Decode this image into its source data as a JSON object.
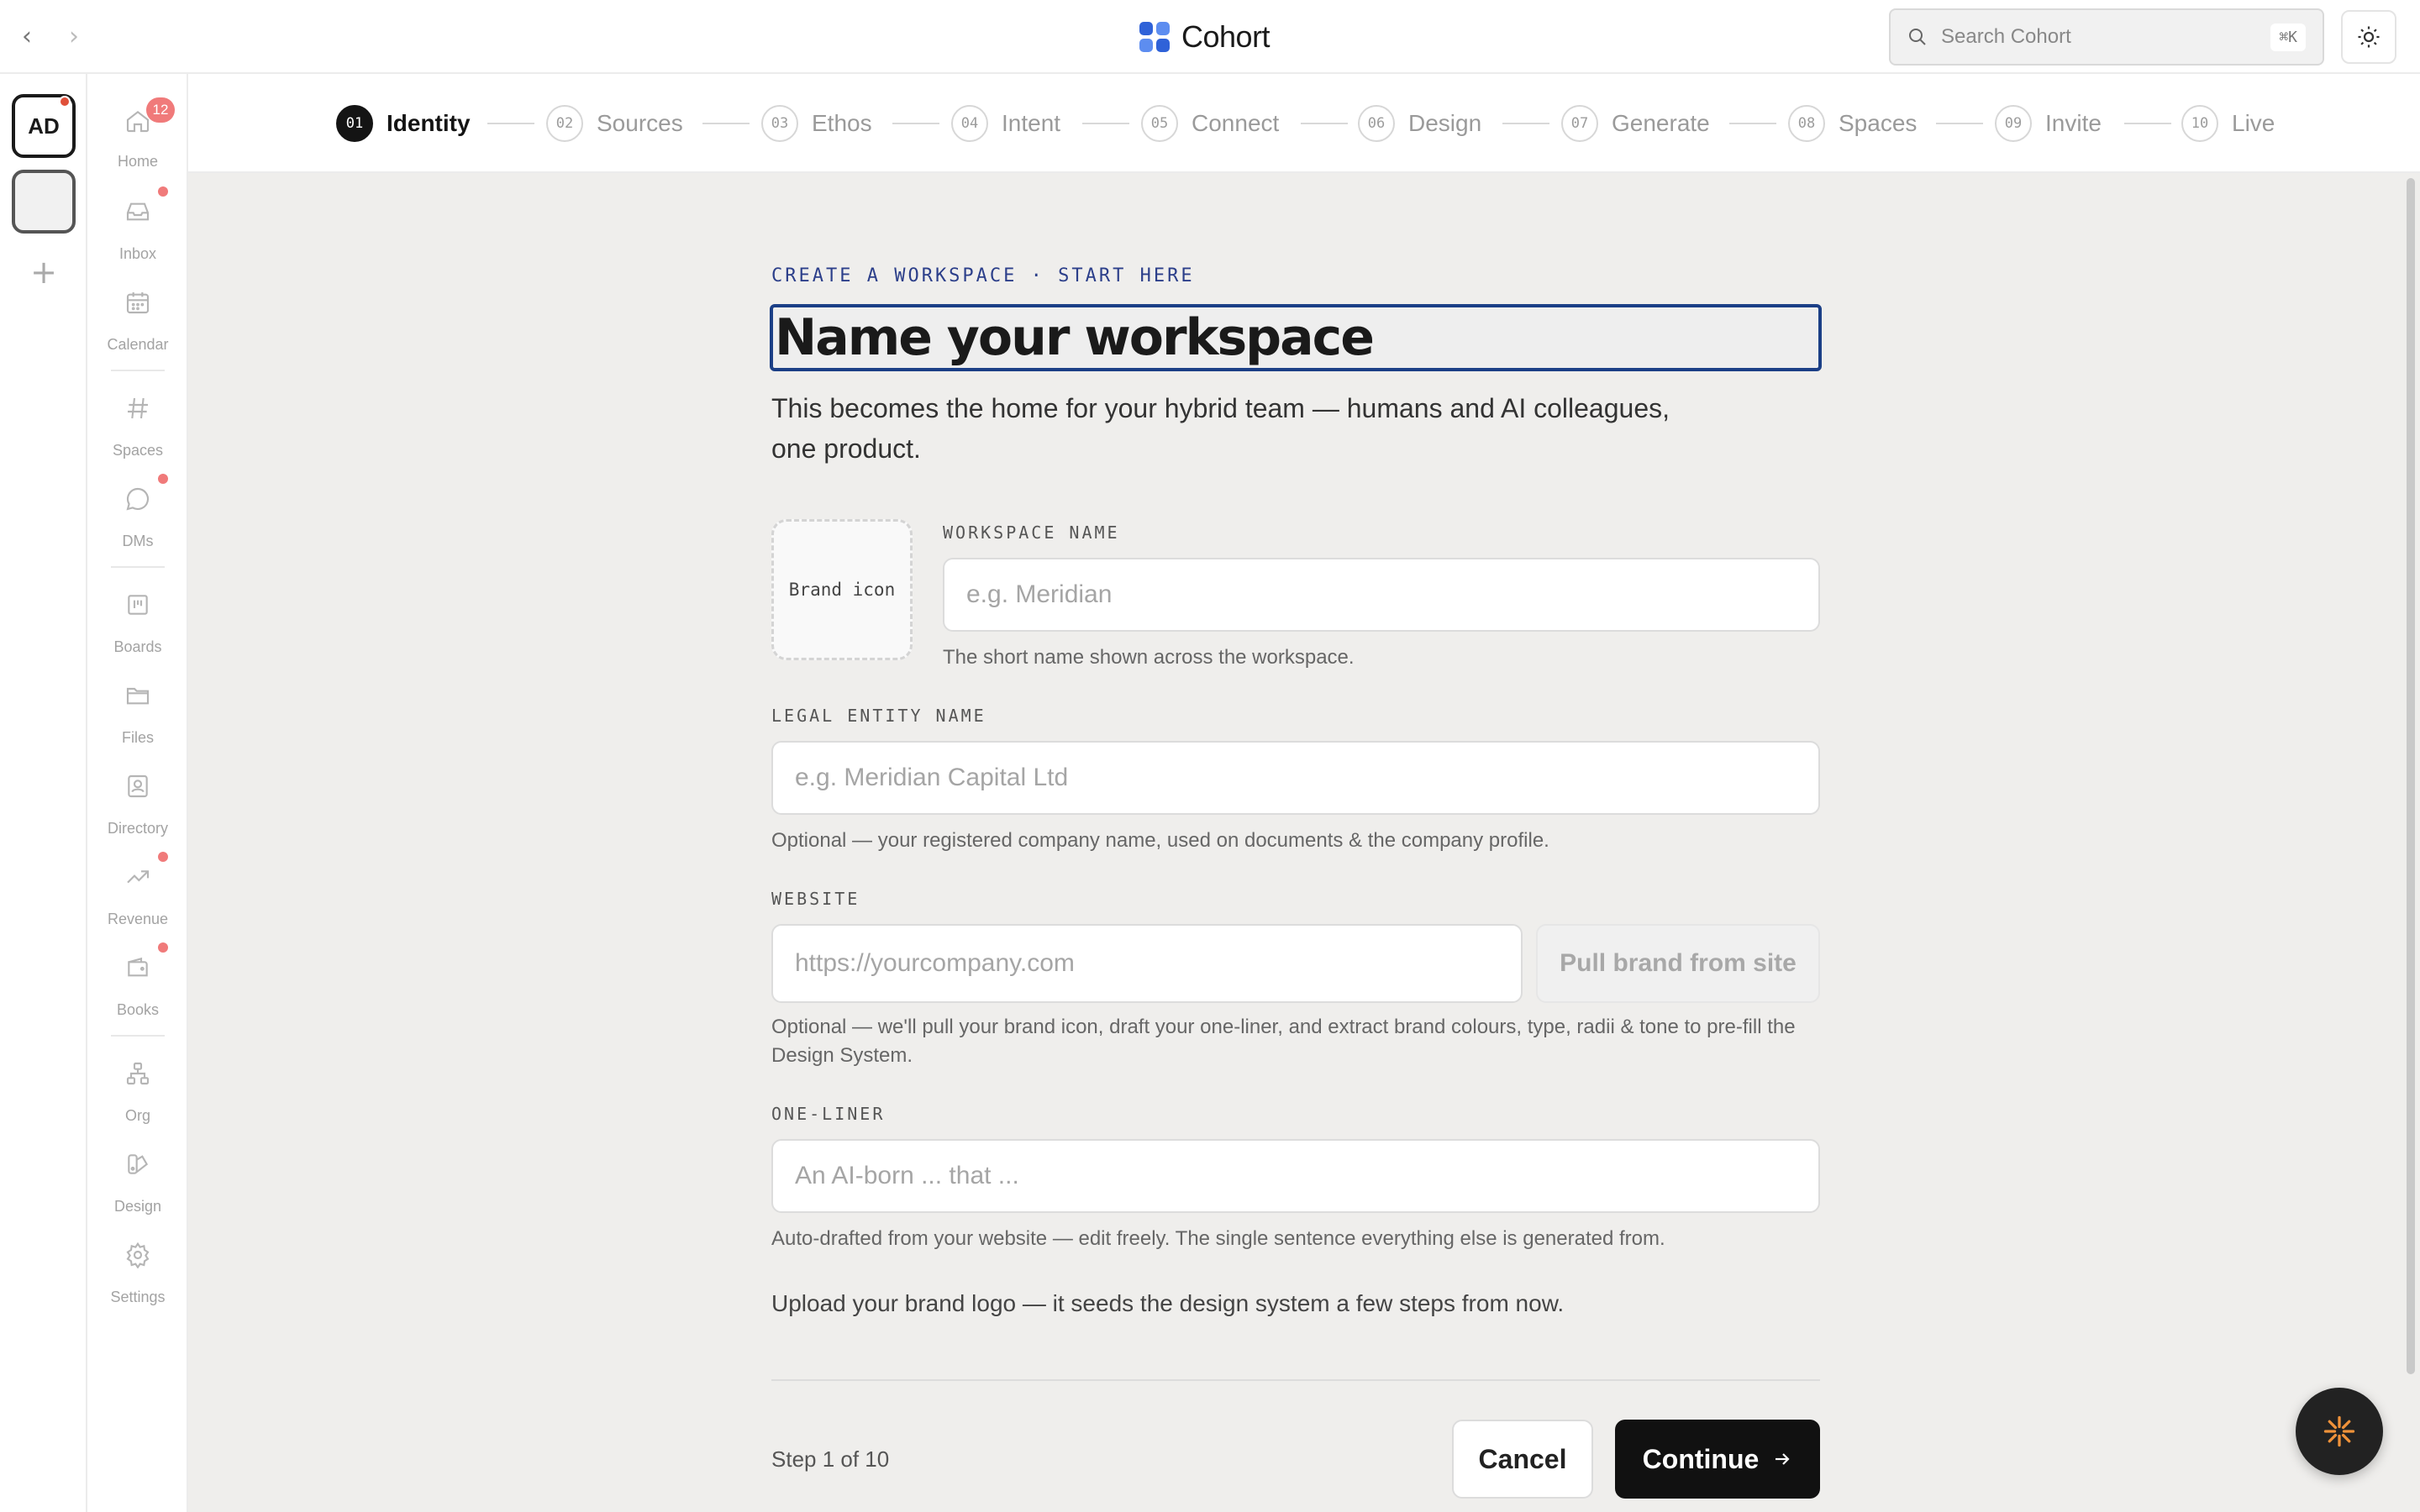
{
  "app": {
    "name": "Cohort"
  },
  "topbar": {
    "back_label": "‹",
    "forward_label": "›",
    "search_placeholder": "Search Cohort",
    "search_shortcut": "⌘K",
    "theme_icon": "sun-icon"
  },
  "rail": {
    "workspace_initials": "AD",
    "add_label": "+"
  },
  "sidebar": {
    "items": [
      {
        "label": "Home",
        "icon": "home-icon",
        "badge": "12"
      },
      {
        "label": "Inbox",
        "icon": "inbox-icon",
        "dot": true
      },
      {
        "label": "Calendar",
        "icon": "calendar-icon"
      },
      {
        "label": "Spaces",
        "icon": "hash-icon"
      },
      {
        "label": "DMs",
        "icon": "chat-bubble-icon",
        "dot": true
      },
      {
        "label": "Boards",
        "icon": "board-icon"
      },
      {
        "label": "Files",
        "icon": "folder-icon"
      },
      {
        "label": "Directory",
        "icon": "contact-book-icon"
      },
      {
        "label": "Revenue",
        "icon": "trend-up-icon",
        "dot": true
      },
      {
        "label": "Books",
        "icon": "wallet-icon",
        "dot": true
      },
      {
        "label": "Org",
        "icon": "org-chart-icon"
      },
      {
        "label": "Design",
        "icon": "palette-icon"
      },
      {
        "label": "Settings",
        "icon": "gear-icon"
      }
    ]
  },
  "stepper": {
    "steps": [
      {
        "num": "01",
        "label": "Identity",
        "active": true
      },
      {
        "num": "02",
        "label": "Sources"
      },
      {
        "num": "03",
        "label": "Ethos"
      },
      {
        "num": "04",
        "label": "Intent"
      },
      {
        "num": "05",
        "label": "Connect"
      },
      {
        "num": "06",
        "label": "Design"
      },
      {
        "num": "07",
        "label": "Generate"
      },
      {
        "num": "08",
        "label": "Spaces"
      },
      {
        "num": "09",
        "label": "Invite"
      },
      {
        "num": "10",
        "label": "Live"
      }
    ]
  },
  "form": {
    "eyebrow": "CREATE A WORKSPACE · START HERE",
    "title_placeholder": "Name your workspace",
    "subtitle": "This becomes the home for your hybrid team — humans and AI colleagues, one product.",
    "brand_icon_label": "Brand icon",
    "workspace_name": {
      "label": "WORKSPACE NAME",
      "placeholder": "e.g. Meridian",
      "hint": "The short name shown across the workspace."
    },
    "legal_name": {
      "label": "LEGAL ENTITY NAME",
      "placeholder": "e.g. Meridian Capital Ltd",
      "hint": "Optional — your registered company name, used on documents & the company profile."
    },
    "website": {
      "label": "WEBSITE",
      "placeholder": "https://yourcompany.com",
      "button": "Pull brand from site",
      "hint": "Optional — we'll pull your brand icon, draft your one-liner, and extract brand colours, type, radii & tone to pre-fill the Design System."
    },
    "one_liner": {
      "label": "ONE-LINER",
      "placeholder": "An AI-born ... that ...",
      "hint": "Auto-drafted from your website — edit freely. The single sentence everything else is generated from."
    },
    "upload_note": "Upload your brand logo — it seeds the design system a few steps from now."
  },
  "footer": {
    "step_count": "Step 1 of 10",
    "cancel": "Cancel",
    "continue": "Continue",
    "continue_icon": "arrow-right-icon"
  },
  "colors": {
    "accent": "#1b3f86",
    "brand_blue": "#2f62d8",
    "badge_red": "#f07a7a",
    "primary_button": "#111111"
  }
}
